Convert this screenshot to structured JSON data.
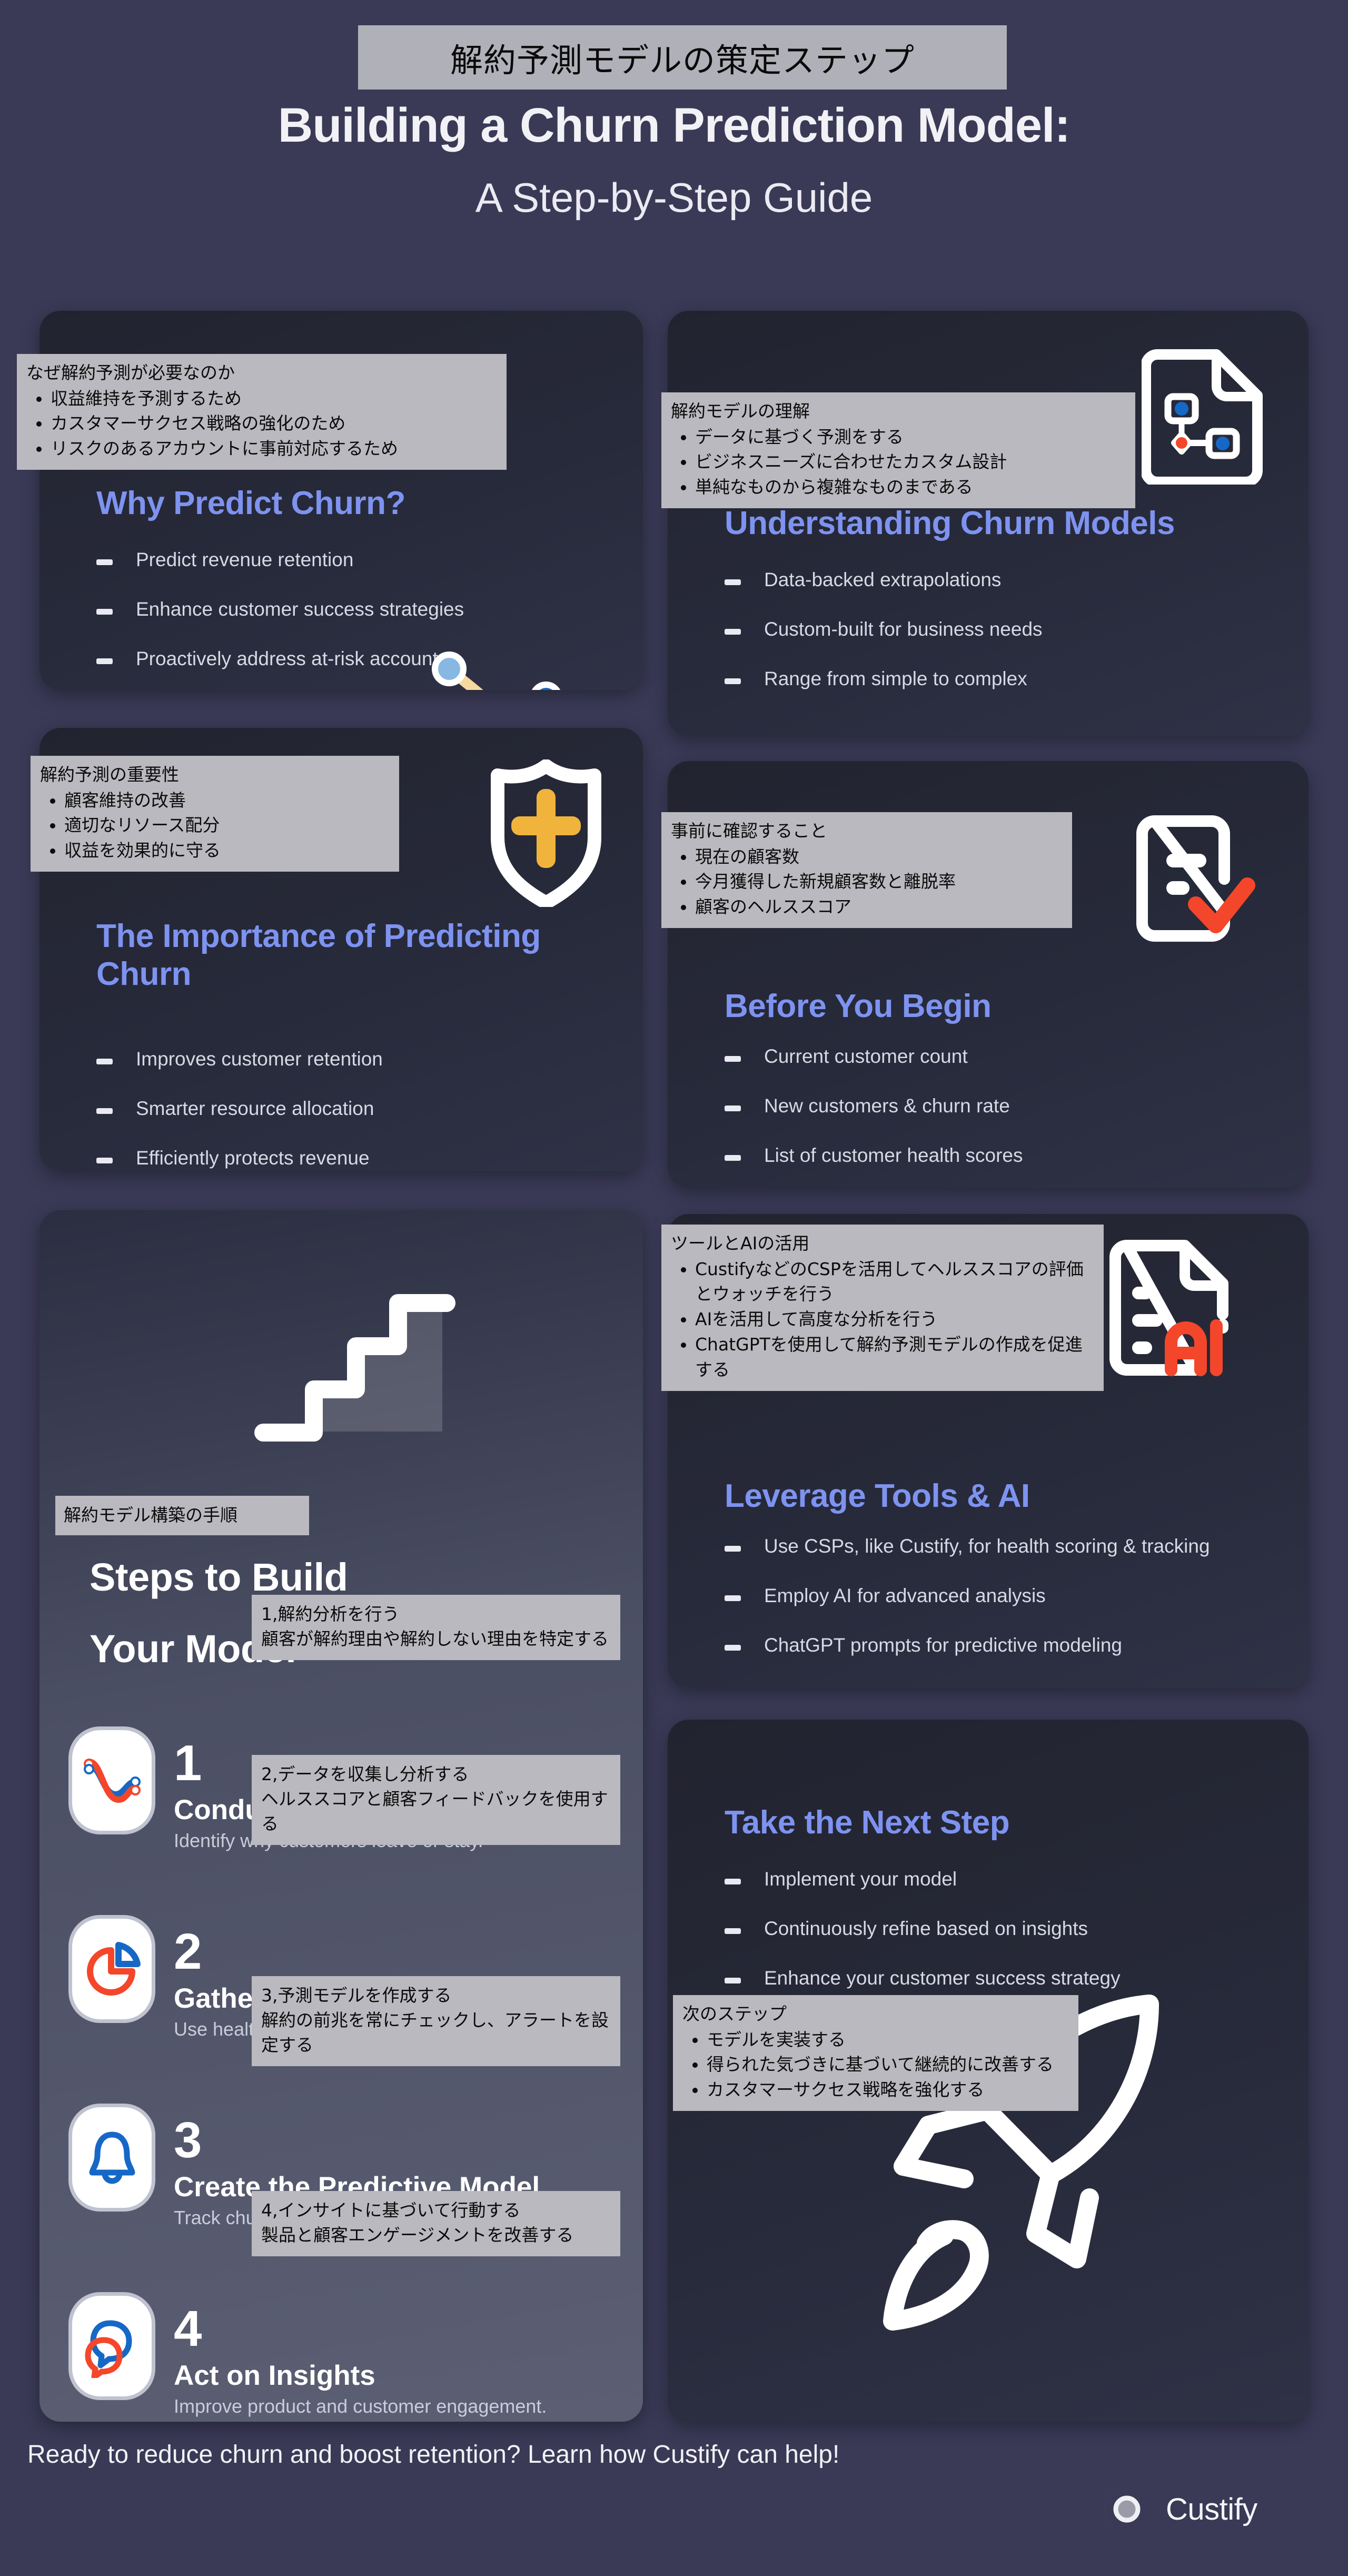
{
  "header": {
    "jp_badge": "解約予測モデルの策定ステップ",
    "title_main": "Building a Churn Prediction Model:",
    "title_sub": "A Step-by-Step Guide"
  },
  "colors": {
    "page_bg": "#3a3a57",
    "card_bg_dark": "#272a3a",
    "card_bg_steps": "#4b4f63",
    "accent_blue": "#7e93f0",
    "overlay_gray": "#b9b9bf",
    "icon_red": "#f4462a",
    "icon_blue": "#1668c7",
    "icon_amber": "#f0b43c",
    "text_light": "#d7d9e4"
  },
  "cards": [
    {
      "id": "why-predict-churn",
      "title": "Why Predict Churn?",
      "icon": "line-chart-magnifier-icon",
      "bullets": [
        "Predict revenue retention",
        "Enhance customer success strategies",
        "Proactively address at-risk accounts"
      ],
      "jp": {
        "head": "なぜ解約予測が必要なのか",
        "items": [
          "収益維持を予測するため",
          "カスタマーサクセス戦略の強化のため",
          "リスクのあるアカウントに事前対応するため"
        ]
      }
    },
    {
      "id": "understanding-churn-models",
      "title": "Understanding Churn Models",
      "icon": "document-flowchart-icon",
      "bullets": [
        "Data-backed extrapolations",
        "Custom-built for business needs",
        "Range from simple to complex"
      ],
      "jp": {
        "head": "解約モデルの理解",
        "items": [
          "データに基づく予測をする",
          "ビジネスニーズに合わせたカスタム設計",
          "単純なものから複雑なものまである"
        ]
      }
    },
    {
      "id": "importance-of-predicting-churn",
      "title": "The Importance of Predicting Churn",
      "icon": "shield-plus-icon",
      "bullets": [
        "Improves customer retention",
        "Smarter resource allocation",
        "Efficiently protects revenue"
      ],
      "jp": {
        "head": "解約予測の重要性",
        "items": [
          "顧客維持の改善",
          "適切なリソース配分",
          "収益を効果的に守る"
        ]
      }
    },
    {
      "id": "before-you-begin",
      "title": "Before You Begin",
      "icon": "checklist-check-icon",
      "bullets": [
        "Current customer count",
        "New customers & churn rate",
        "List of customer health scores"
      ],
      "jp": {
        "head": "事前に確認すること",
        "items": [
          "現在の顧客数",
          "今月獲得した新規顧客数と離脱率",
          "顧客のヘルススコア"
        ]
      }
    },
    {
      "id": "leverage-tools-ai",
      "title": "Leverage Tools & AI",
      "icon": "ai-document-icon",
      "bullets": [
        "Use CSPs, like Custify, for health scoring & tracking",
        "Employ AI for advanced analysis",
        "ChatGPT prompts for predictive modeling"
      ],
      "jp": {
        "head": "ツールとAIの活用",
        "items": [
          "CustifyなどのCSPを活用してヘルススコアの評価とウォッチを行う",
          "AIを活用して高度な分析を行う",
          "ChatGPTを使用して解約予測モデルの作成を促進する"
        ]
      }
    },
    {
      "id": "take-the-next-step",
      "title": "Take the Next Step",
      "icon": "rocket-icon",
      "bullets": [
        "Implement your model",
        "Continuously refine based on insights",
        "Enhance your customer success strategy"
      ],
      "jp": {
        "head": "次のステップ",
        "items": [
          "モデルを実装する",
          "得られた気づきに基づいて継続的に改善する",
          "カスタマーサクセス戦略を強化する"
        ]
      }
    }
  ],
  "steps_card": {
    "id": "steps-to-build-your-model",
    "icon": "stairs-icon",
    "jp_badge": "解約モデル構築の手順",
    "title_line1": "Steps to Build",
    "title_line2": "Your Model",
    "steps": [
      {
        "number": "1",
        "icon": "trend-lines-icon",
        "name": "Conduct a Churn Analysis",
        "desc": "Identify why customers leave or stay.",
        "jp_head": "1,解約分析を行う",
        "jp_body": "顧客が解約理由や解約しない理由を特定する"
      },
      {
        "number": "2",
        "icon": "pie-chart-icon",
        "name": "Gather and Analyze Data",
        "desc": "Use health scores and customer feedback.",
        "jp_head": "2,データを収集し分析する",
        "jp_body": "ヘルススコアと顧客フィードバックを使用する"
      },
      {
        "number": "3",
        "icon": "bell-icon",
        "name": "Create the Predictive Model",
        "desc": "Track churn precursors and set alerts.",
        "jp_head": "3,予測モデルを作成する",
        "jp_body": "解約の前兆を常にチェックし、アラートを設定する"
      },
      {
        "number": "4",
        "icon": "speech-bubbles-icon",
        "name": "Act on Insights",
        "desc": "Improve product and customer engagement.",
        "jp_head": "4,インサイトに基づいて行動する",
        "jp_body": "製品と顧客エンゲージメントを改善する"
      }
    ]
  },
  "footer": {
    "cta": "Ready to reduce churn and boost retention? Learn how Custify can help!",
    "brand": "Custify"
  }
}
